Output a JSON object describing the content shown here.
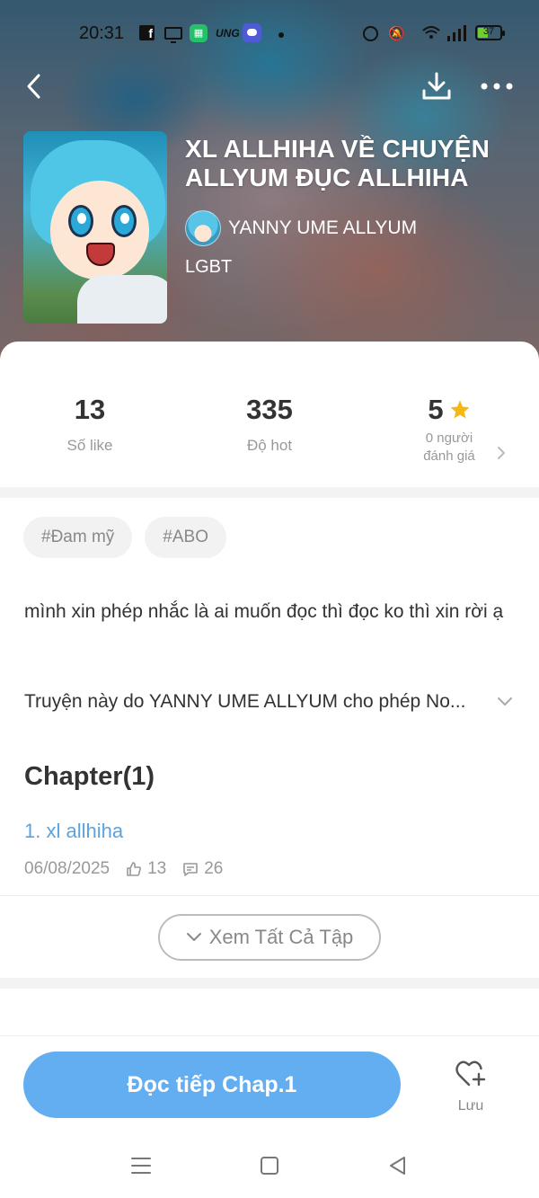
{
  "status_bar": {
    "time": "20:31",
    "ung_label": "UNG",
    "battery": "37",
    "icons": [
      "facebook-icon",
      "screen-icon",
      "green-app-icon",
      "ung-icon",
      "weather-icon",
      "dot-icon",
      "alarm-icon",
      "mute-icon",
      "wifi-icon",
      "signal-icon",
      "battery-icon"
    ]
  },
  "top_nav": {
    "icons": [
      "back-arrow-icon",
      "download-icon",
      "more-dots-icon"
    ]
  },
  "book": {
    "title": "XL ALLHIHA VỀ CHUYỆN ALLYUM ĐỤC ALLHIHA",
    "author": "YANNY UME ALLYUM",
    "genre": "LGBT"
  },
  "stats": {
    "likes": {
      "value": "13",
      "label": "Số like"
    },
    "hot": {
      "value": "335",
      "label": "Độ hot"
    },
    "rating": {
      "value": "5",
      "label_line1": "0 người",
      "label_line2": "đánh giá"
    }
  },
  "tags": [
    "#Đam mỹ",
    "#ABO"
  ],
  "description": {
    "paragraph": "mình xin phép nhắc là ai muốn đọc thì đọc ko thì xin rời ạ",
    "truncated": "Truyện này do YANNY UME ALLYUM cho phép No..."
  },
  "chapters": {
    "heading": "Chapter(1)",
    "items": [
      {
        "title": "1. xl allhiha",
        "date": "06/08/2025",
        "likes": "13",
        "comments": "26"
      }
    ],
    "see_all_label": "Xem Tất Cả Tập"
  },
  "bottom_bar": {
    "read_label": "Đọc tiếp Chap.1",
    "save_label": "Lưu"
  },
  "colors": {
    "accent": "#62aef0",
    "link": "#5ba3df",
    "star": "#f5b915"
  }
}
